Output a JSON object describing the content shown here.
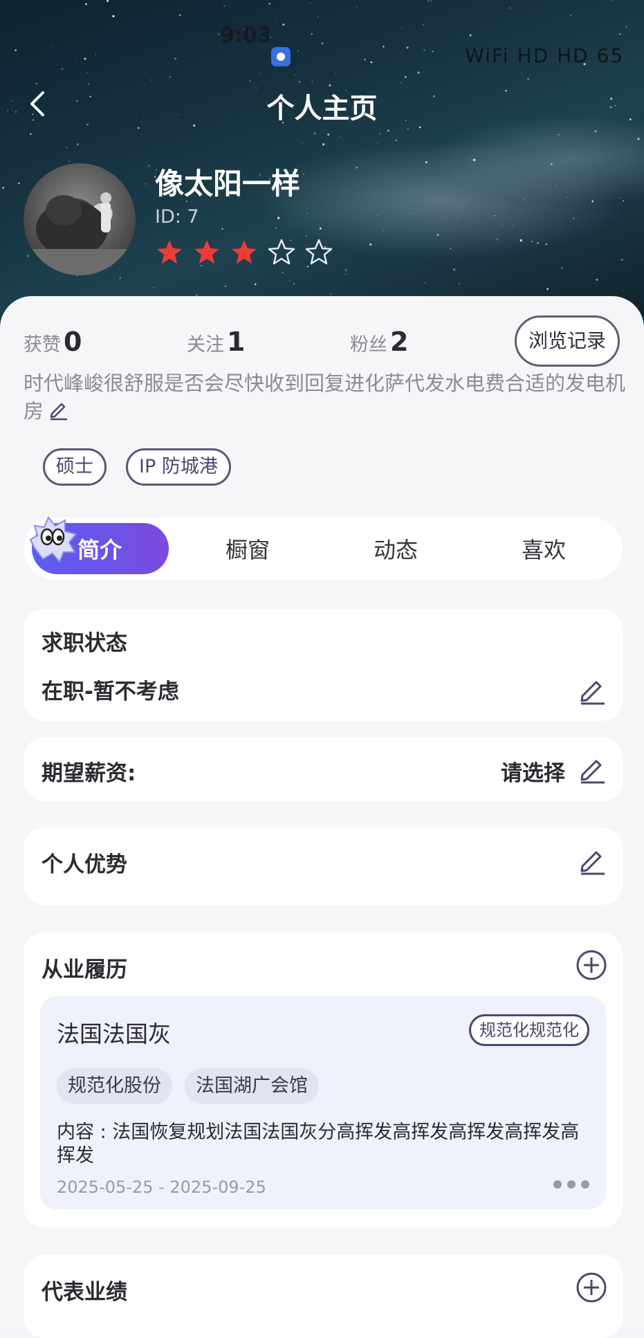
{
  "status_bar": {
    "time": "9:03",
    "indicators": "WiFi HD HD 65"
  },
  "header": {
    "title": "个人主页",
    "back_icon": "chevron-left-icon"
  },
  "profile": {
    "name": "像太阳一样",
    "id_label": "ID:  7",
    "rating": {
      "value": 3,
      "max": 5
    },
    "rating_color": "#ef3b36"
  },
  "stats": [
    {
      "label": "获赞",
      "value": "0"
    },
    {
      "label": "关注",
      "value": "1"
    },
    {
      "label": "粉丝",
      "value": "2"
    }
  ],
  "history_button": "浏览记录",
  "bio": "时代峰峻很舒服是否会尽快收到回复进化萨代发水电费合适的发电机房",
  "tags": [
    "硕士",
    "IP 防城港"
  ],
  "tabs": [
    {
      "label": "简介",
      "active": true
    },
    {
      "label": "橱窗",
      "active": false
    },
    {
      "label": "动态",
      "active": false
    },
    {
      "label": "喜欢",
      "active": false
    }
  ],
  "job_status": {
    "title": "求职状态",
    "value": "在职-暂不考虑"
  },
  "salary": {
    "title": "期望薪资:",
    "value": "请选择"
  },
  "advantage": {
    "title": "个人优势"
  },
  "experience": {
    "title": "从业履历",
    "items": [
      {
        "company": "法国法国灰",
        "badge": "规范化规范化",
        "chips": [
          "规范化股份",
          "法国湖广会馆"
        ],
        "content": "内容 : 法国恢复规划法国法国灰分高挥发高挥发高挥发高挥发高挥发",
        "date": "2025-05-25 - 2025-09-25"
      }
    ]
  },
  "achievements": {
    "title": "代表业绩"
  },
  "colors": {
    "accent_start": "#5b5cf5",
    "accent_end": "#7b4bdc",
    "icon": "#4b4670"
  }
}
